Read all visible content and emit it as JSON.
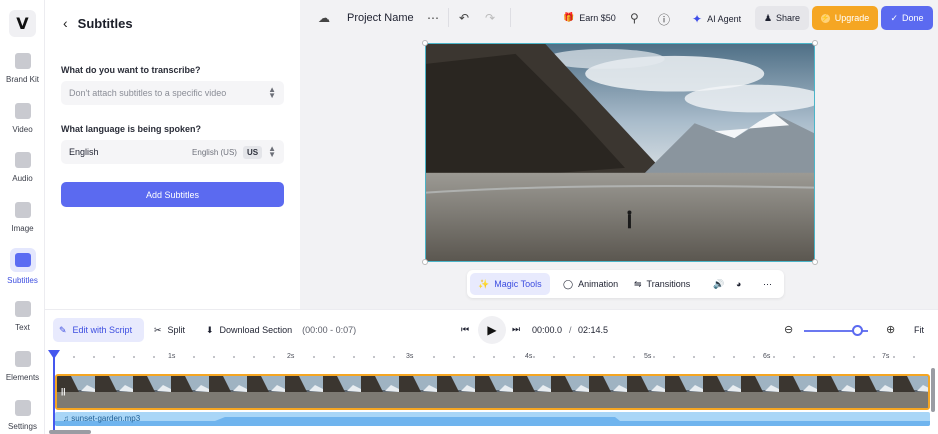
{
  "rail": {
    "logo": "V",
    "items": [
      {
        "label": "Brand Kit",
        "icon": "brand-kit-icon"
      },
      {
        "label": "Video",
        "icon": "video-icon"
      },
      {
        "label": "Audio",
        "icon": "audio-icon"
      },
      {
        "label": "Image",
        "icon": "image-icon"
      },
      {
        "label": "Subtitles",
        "icon": "subtitles-icon"
      },
      {
        "label": "Text",
        "icon": "text-icon"
      },
      {
        "label": "Elements",
        "icon": "elements-icon"
      },
      {
        "label": "Settings",
        "icon": "settings-icon"
      }
    ]
  },
  "panel": {
    "title": "Subtitles",
    "transcribe_question": "What do you want to transcribe?",
    "transcribe_select": "Don't attach subtitles to a specific video",
    "language_question": "What language is being spoken?",
    "language_name": "English",
    "language_region": "English (US)",
    "language_code": "US",
    "add_button": "Add Subtitles"
  },
  "topbar": {
    "project_name": "Project Name",
    "earn": "Earn $50",
    "ai_agent": "AI Agent",
    "share": "Share",
    "upgrade": "Upgrade",
    "done": "Done"
  },
  "magic_bar": {
    "magic_tools": "Magic Tools",
    "animation": "Animation",
    "transitions": "Transitions"
  },
  "timeline": {
    "edit_script": "Edit with Script",
    "split": "Split",
    "download_section": "Download Section",
    "section_range": "(00:00 - 0:07)",
    "current_time": "00:00.0",
    "time_separator": "/",
    "total_time": "02:14.5",
    "fit": "Fit",
    "ticks": [
      "1s",
      "2s",
      "3s",
      "4s",
      "5s",
      "6s",
      "7s"
    ],
    "audio_file": "sunset-garden.mp3",
    "zoom_level": 0.85
  },
  "colors": {
    "accent": "#5b6af0",
    "upgrade": "#f5a623",
    "selection": "#4bb5c8",
    "track_border": "#f5a623",
    "audio": "#a9d6f7"
  }
}
